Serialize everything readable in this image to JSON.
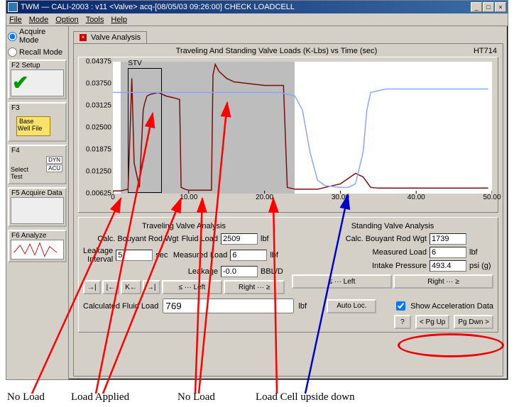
{
  "titlebar": {
    "text": "TWM — CALI-2003 : v11  <Valve>  acq-[08/05/03 09:26:00]  CHECK LOADCELL",
    "min": "_",
    "max": "□",
    "close": "×"
  },
  "menu": {
    "file": "File",
    "mode": "Mode",
    "option": "Option",
    "tools": "Tools",
    "help": "Help"
  },
  "sidebar": {
    "acquire": "Acquire Mode",
    "recall": "Recall Mode",
    "btns": {
      "f2": "F2 Setup",
      "f3": "F3",
      "f3sub1": "Base",
      "f3sub2": "Well File",
      "f4": "F4",
      "f4sub": "Select Test",
      "f4dyn": "DYN",
      "f4acu": "ACU",
      "f5": "F5 Acquire Data",
      "f6": "F6 Analyze"
    }
  },
  "tab": {
    "label": "Valve Analysis"
  },
  "chart": {
    "title": "Traveling And Standing  Valve Loads (K-Lbs) vs Time (sec)",
    "right": "HT714",
    "stv": "STV"
  },
  "chart_data": {
    "type": "line",
    "xlabel": "Time (sec)",
    "ylabel": "K-Lbs",
    "xlim": [
      0,
      50
    ],
    "ylim": [
      0.00625,
      0.04375
    ],
    "x_ticks": [
      0,
      10.0,
      20.0,
      30.0,
      40.0,
      50.0
    ],
    "y_ticks": [
      0.00625,
      0.0125,
      0.01875,
      0.025,
      0.03125,
      0.0375,
      0.04375
    ],
    "shaded_region": {
      "x0": 1.0,
      "x1": 24.0
    },
    "stv_box": {
      "x0": 2.0,
      "x1": 6.5,
      "y0": 0.0065,
      "y1": 0.042
    },
    "series": [
      {
        "name": "Valve Load (red)",
        "color": "#7a0d0d",
        "points": [
          [
            0.0,
            0.007
          ],
          [
            1.0,
            0.007
          ],
          [
            2.0,
            0.0075
          ],
          [
            2.5,
            0.039
          ],
          [
            2.8,
            0.015
          ],
          [
            3.5,
            0.008
          ],
          [
            4.0,
            0.03
          ],
          [
            4.2,
            0.032
          ],
          [
            4.5,
            0.034
          ],
          [
            5.0,
            0.0345
          ],
          [
            6.0,
            0.035
          ],
          [
            7.0,
            0.034
          ],
          [
            8.0,
            0.0335
          ],
          [
            8.8,
            0.033
          ],
          [
            9.0,
            0.008
          ],
          [
            9.5,
            0.0075
          ],
          [
            10.0,
            0.0072
          ],
          [
            12.0,
            0.0072
          ],
          [
            13.0,
            0.0072
          ],
          [
            13.2,
            0.04
          ],
          [
            13.5,
            0.043
          ],
          [
            14.0,
            0.041
          ],
          [
            15.0,
            0.039
          ],
          [
            16.0,
            0.038
          ],
          [
            18.0,
            0.0375
          ],
          [
            20.0,
            0.037
          ],
          [
            22.0,
            0.037
          ],
          [
            22.5,
            0.037
          ],
          [
            23.0,
            0.008
          ],
          [
            24.0,
            0.0075
          ],
          [
            27.0,
            0.0075
          ],
          [
            28.0,
            0.008
          ],
          [
            30.0,
            0.009
          ],
          [
            32.0,
            0.012
          ],
          [
            33.0,
            0.011
          ],
          [
            34.0,
            0.008
          ],
          [
            35.0,
            0.0078
          ],
          [
            40.0,
            0.0078
          ],
          [
            45.0,
            0.0078
          ],
          [
            49.5,
            0.0078
          ]
        ]
      },
      {
        "name": "Aux (blue)",
        "color": "#8aa6ff",
        "points": [
          [
            0.0,
            0.035
          ],
          [
            22.0,
            0.035
          ],
          [
            24.0,
            0.034
          ],
          [
            25.0,
            0.03
          ],
          [
            26.0,
            0.018
          ],
          [
            27.0,
            0.01
          ],
          [
            28.0,
            0.0085
          ],
          [
            30.0,
            0.008
          ],
          [
            31.0,
            0.008
          ],
          [
            32.0,
            0.009
          ],
          [
            33.0,
            0.018
          ],
          [
            33.5,
            0.03
          ],
          [
            34.0,
            0.035
          ],
          [
            36.0,
            0.036
          ],
          [
            45.0,
            0.036
          ],
          [
            49.5,
            0.036
          ]
        ]
      }
    ]
  },
  "analysis": {
    "traveling": {
      "title": "Traveling Valve Analysis",
      "calc_buoyant": {
        "label": "Calc. Bouyant Rod Wgt"
      },
      "fluid_load": {
        "label": "Fluid Load",
        "value": "2509",
        "unit": "lbf"
      },
      "measured_load": {
        "label": "Measured Load",
        "value": "6",
        "unit": "lbf"
      },
      "leakage_interval": {
        "label": "Leakage Interval",
        "value": "5",
        "unit": "sec"
      },
      "leakage": {
        "label": "Leakage",
        "value": "-0.0",
        "unit": "BBL/D"
      }
    },
    "standing": {
      "title": "Standing Valve Analysis",
      "calc_buoyant": {
        "label": "Calc. Bouyant Rod Wgt",
        "value": "1739"
      },
      "measured_load": {
        "label": "Measured Load",
        "value": "6",
        "unit": "lbf"
      },
      "intake_pressure": {
        "label": "Intake Pressure",
        "value": "493.4",
        "unit": "psi (g)"
      }
    },
    "nav": {
      "first": "→|",
      "prev2": "|←",
      "prev1": "K←",
      "next1": "→|",
      "left": "≤ ··· Left",
      "right": "Right ··· ≥",
      "left2": "≤ ··· Left",
      "right2": "Right ··· ≥"
    },
    "calc_fluid_load": {
      "label": "Calculated Fluid Load",
      "value": "769",
      "unit": "lbf"
    },
    "auto_loc": "Auto Loc.",
    "show_accel": "Show Acceleration Data",
    "q": "?",
    "pgup": "< Pg Up",
    "pgdn": "Pg Dwn >"
  },
  "annotations": {
    "no_load1": "No Load",
    "load_applied": "Load Applied",
    "no_load2": "No Load",
    "upside_down": "Load Cell upside down"
  }
}
